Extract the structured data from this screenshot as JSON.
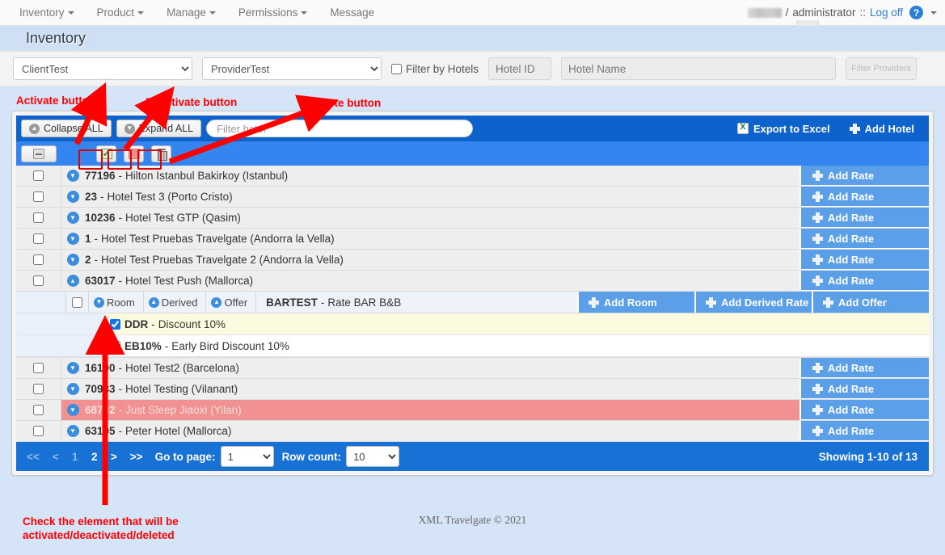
{
  "nav": {
    "items": [
      {
        "label": "Inventory",
        "caret": true
      },
      {
        "label": "Product",
        "caret": true
      },
      {
        "label": "Manage",
        "caret": true
      },
      {
        "label": "Permissions",
        "caret": true
      },
      {
        "label": "Message",
        "caret": false
      }
    ],
    "user_separator": "/",
    "role": "administrator",
    "role_separator": "::",
    "logoff": "Log off",
    "help_glyph": "?"
  },
  "header": {
    "title": "Inventory"
  },
  "filters": {
    "client_selected": "ClientTest",
    "provider_selected": "ProviderTest",
    "filter_by_hotels_label": "Filter by Hotels",
    "hotel_id_placeholder": "Hotel ID",
    "hotel_id_value": "",
    "hotel_name_placeholder": "Hotel Name",
    "hotel_name_value": "",
    "filter_providers_label": "Filter Providers"
  },
  "toolbar": {
    "collapse_all": "Collapse ALL",
    "expand_all": "Expand ALL",
    "filter_hotel_placeholder": "Filter hotel",
    "filter_hotel_value": "",
    "export_excel": "Export to Excel",
    "add_hotel": "Add Hotel"
  },
  "actions": {
    "activate_title": "Activate",
    "deactivate_title": "Deactivate",
    "delete_title": "Delete"
  },
  "grid": {
    "add_rate_label": "Add Rate",
    "rows": [
      {
        "id": "77196",
        "dash": "-",
        "name": "Hilton Istanbul Bakirkoy (Istanbul)",
        "expanded": false,
        "inactive": false,
        "checked": false
      },
      {
        "id": "23",
        "dash": "-",
        "name": "Hotel Test 3 (Porto Cristo)",
        "expanded": false,
        "inactive": false,
        "checked": false
      },
      {
        "id": "10236",
        "dash": "-",
        "name": "Hotel Test GTP (Qasim)",
        "expanded": false,
        "inactive": false,
        "checked": false
      },
      {
        "id": "1",
        "dash": "-",
        "name": "Hotel Test Pruebas Travelgate (Andorra la Vella)",
        "expanded": false,
        "inactive": false,
        "checked": false
      },
      {
        "id": "2",
        "dash": "-",
        "name": "Hotel Test Pruebas Travelgate 2 (Andorra la Vella)",
        "expanded": false,
        "inactive": false,
        "checked": false
      },
      {
        "id": "63017",
        "dash": "-",
        "name": "Hotel Test Push (Mallorca)",
        "expanded": true,
        "inactive": false,
        "checked": false
      },
      {
        "id": "16100",
        "dash": "-",
        "name": "Hotel Test2 (Barcelona)",
        "expanded": false,
        "inactive": false,
        "checked": false
      },
      {
        "id": "70983",
        "dash": "-",
        "name": "Hotel Testing (Vilanant)",
        "expanded": false,
        "inactive": false,
        "checked": false
      },
      {
        "id": "68702",
        "dash": "-",
        "name": "Just Sleep Jiaoxi (Yilan)",
        "expanded": false,
        "inactive": true,
        "checked": false
      },
      {
        "id": "63105",
        "dash": "-",
        "name": "Peter Hotel (Mallorca)",
        "expanded": false,
        "inactive": false,
        "checked": false
      }
    ]
  },
  "sub_section": {
    "tabs": [
      {
        "label": "Room",
        "state": "collapsed"
      },
      {
        "label": "Derived",
        "state": "expanded"
      },
      {
        "label": "Offer",
        "state": "expanded"
      }
    ],
    "rate_code": "BARTEST",
    "rate_dash": "-",
    "rate_name": "Rate BAR B&B",
    "add_room": "Add Room",
    "add_derived_rate": "Add Derived Rate",
    "add_offer": "Add Offer",
    "rows": [
      {
        "code": "DDR",
        "dash": "-",
        "name": "Discount 10%",
        "checked": true,
        "highlight": true
      },
      {
        "code": "EB10%",
        "dash": "-",
        "name": "Early Bird Discount 10%",
        "checked": false,
        "highlight": false
      }
    ]
  },
  "pager": {
    "first": "<<",
    "prev": "<",
    "page1": "1",
    "page2": "2",
    "next": ">",
    "last": ">>",
    "go_to_page_label": "Go to page:",
    "go_to_page_value": "1",
    "row_count_label": "Row count:",
    "row_count_value": "10",
    "showing": "Showing 1-10 of 13"
  },
  "footer": {
    "copyright": "XML Travelgate © 2021"
  },
  "annotations": {
    "activate": "Activate button",
    "deactivate": "Deactivate button",
    "delete": "Delete button",
    "check_note": "Check the element that will be activated/deactivated/deleted",
    "color": "#ff0000"
  }
}
